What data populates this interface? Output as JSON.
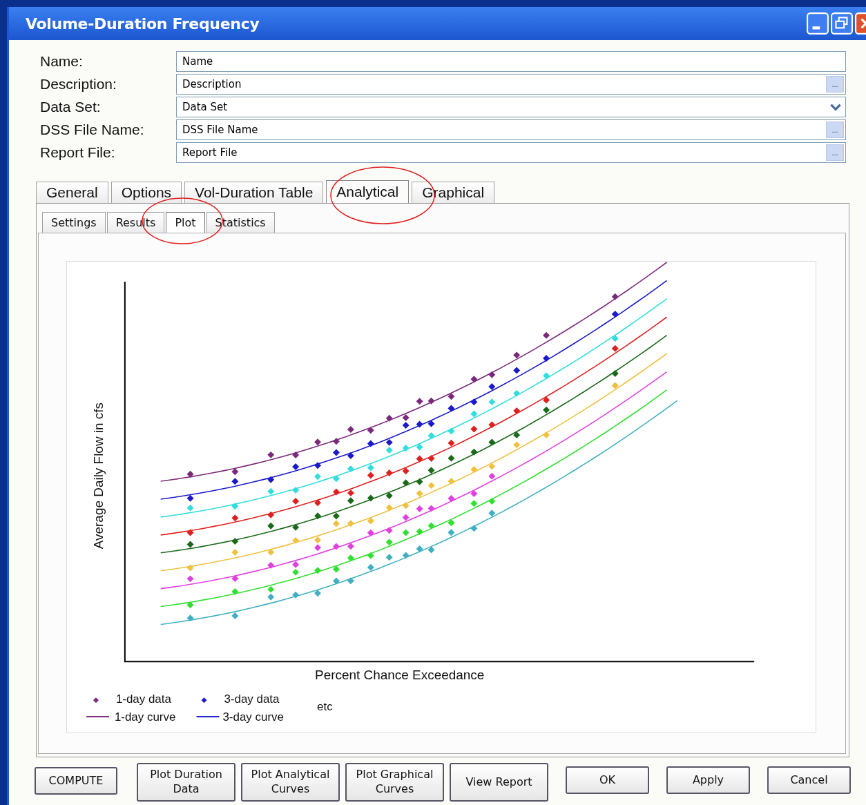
{
  "window": {
    "title": "Volume-Duration Frequency"
  },
  "fields": [
    {
      "label": "Name:",
      "value": "Name",
      "kind": "text"
    },
    {
      "label": "Description:",
      "value": "Description",
      "kind": "browse",
      "button_label": "..."
    },
    {
      "label": "Data Set:",
      "value": "Data Set",
      "kind": "dropdown"
    },
    {
      "label": "DSS File Name:",
      "value": "DSS File Name",
      "kind": "browse",
      "button_label": "..."
    },
    {
      "label": "Report File:",
      "value": "Report File",
      "kind": "browse",
      "button_label": "..."
    }
  ],
  "tabs": [
    {
      "label": "General",
      "selected": false
    },
    {
      "label": "Options",
      "selected": false
    },
    {
      "label": "Vol-Duration Table",
      "selected": false
    },
    {
      "label": "Analytical",
      "selected": true
    },
    {
      "label": "Graphical",
      "selected": false
    }
  ],
  "subtabs": [
    {
      "label": "Settings",
      "selected": false
    },
    {
      "label": "Results",
      "selected": false
    },
    {
      "label": "Plot",
      "selected": true
    },
    {
      "label": "Statistics",
      "selected": false
    }
  ],
  "plot": {
    "xlabel": "Percent Chance Exceedance",
    "ylabel": "Average Daily Flow in cfs",
    "legend": [
      {
        "kind": "marker",
        "label": "1-day data",
        "color": "#7b2a7b"
      },
      {
        "kind": "marker",
        "label": "3-day data",
        "color": "#1a1acc"
      },
      {
        "kind": "line",
        "label": "1-day curve",
        "color": "#7b2a7b"
      },
      {
        "kind": "line",
        "label": "3-day curve",
        "color": "#1a1acc"
      }
    ],
    "note": "etc"
  },
  "buttons": [
    {
      "label": "COMPUTE",
      "kind": "action"
    },
    {
      "label": "Plot Duration Data",
      "kind": "action"
    },
    {
      "label": "Plot Analytical Curves",
      "kind": "action"
    },
    {
      "label": "Plot Graphical Curves",
      "kind": "action"
    },
    {
      "label": "View Report",
      "kind": "action"
    },
    {
      "label": "OK",
      "kind": "dialog"
    },
    {
      "label": "Apply",
      "kind": "dialog"
    },
    {
      "label": "Cancel",
      "kind": "dialog"
    }
  ]
}
